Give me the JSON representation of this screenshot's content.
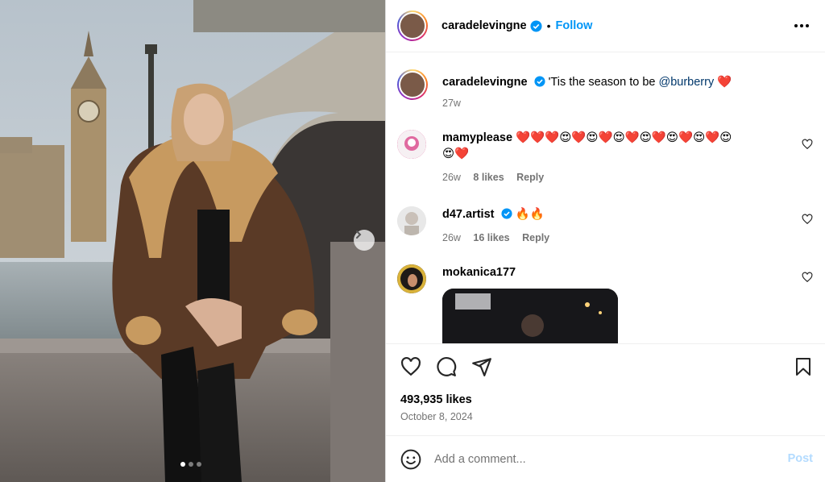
{
  "post": {
    "author": "caradelevingne",
    "follow_label": "Follow",
    "separator": "•",
    "caption_prefix": "'Tis the season to be ",
    "caption_mention": "@burberry",
    "caption_emoji": "❤️",
    "caption_age": "27w",
    "likes": "493,935 likes",
    "date": "October 8, 2024",
    "carousel_index": 1,
    "carousel_count": 3
  },
  "comments": [
    {
      "user": "mamyplease",
      "text_line1": "❤️❤️❤️😍❤️😍❤️😍❤️😍❤️😍❤️😍❤️😍",
      "text_line2": "😍❤️",
      "age": "26w",
      "likes": "8 likes",
      "reply": "Reply"
    },
    {
      "user": "d47.artist",
      "verified": true,
      "text": "🔥🔥",
      "age": "26w",
      "likes": "16 likes",
      "reply": "Reply"
    },
    {
      "user": "mokanica177",
      "has_gif": true
    }
  ],
  "composer": {
    "placeholder": "Add a comment...",
    "post_label": "Post"
  },
  "colors": {
    "accent": "#0095f6",
    "mention": "#00376b",
    "muted": "#737373",
    "post_disabled": "#b3dbff"
  }
}
